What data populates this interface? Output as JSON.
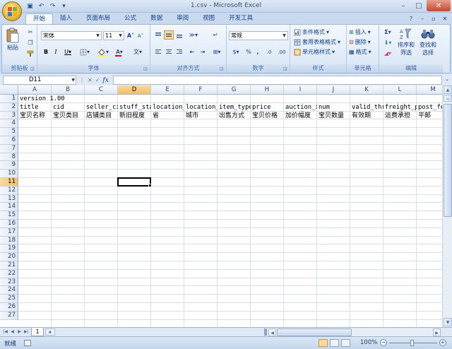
{
  "window": {
    "title": "1.csv - Microsoft Excel"
  },
  "tabs": [
    "开始",
    "插入",
    "页面布局",
    "公式",
    "数据",
    "审阅",
    "视图",
    "开发工具"
  ],
  "ribbon": {
    "clipboard": {
      "label": "剪贴板",
      "paste": "粘贴"
    },
    "font": {
      "label": "字体",
      "name": "宋体",
      "size": "11",
      "bold": "B",
      "italic": "I",
      "underline": "U",
      "grow": "A",
      "shrink": "A",
      "color_letter": "A",
      "phonetic": "文"
    },
    "alignment": {
      "label": "对齐方式"
    },
    "number": {
      "label": "数字",
      "format": "常规",
      "percent": "%",
      "comma": ",",
      "dec_inc": ".0",
      "dec_dec": ".00"
    },
    "styles": {
      "label": "样式",
      "conditional": "条件格式",
      "table": "套用表格格式",
      "cell_styles": "单元格样式"
    },
    "cells": {
      "label": "单元格",
      "insert": "插入",
      "delete": "删除",
      "format": "格式"
    },
    "editing": {
      "label": "编辑",
      "sigma": "Σ",
      "sort": "排序和",
      "sort2": "筛选",
      "find": "查找和",
      "find2": "选择"
    }
  },
  "formula_bar": {
    "name_box": "D11",
    "fx": "fx",
    "value": ""
  },
  "grid": {
    "columns": [
      "A",
      "B",
      "C",
      "D",
      "E",
      "F",
      "G",
      "H",
      "I",
      "J",
      "K",
      "L",
      "M"
    ],
    "rows": [
      "1",
      "2",
      "3",
      "4",
      "5",
      "6",
      "7",
      "8",
      "9",
      "10",
      "11",
      "12",
      "13",
      "14",
      "15",
      "16",
      "17",
      "18",
      "19",
      "20",
      "21",
      "22",
      "23",
      "24",
      "25",
      "26",
      "27"
    ],
    "cells": [
      {
        "row": 0,
        "col": 0,
        "text": "version 1.00",
        "mono": true
      },
      {
        "row": 1,
        "col": 0,
        "text": "title",
        "mono": true
      },
      {
        "row": 1,
        "col": 1,
        "text": "cid",
        "mono": true
      },
      {
        "row": 1,
        "col": 2,
        "text": "seller_ci",
        "mono": true
      },
      {
        "row": 1,
        "col": 3,
        "text": "stuff_sta",
        "mono": true
      },
      {
        "row": 1,
        "col": 4,
        "text": "location_",
        "mono": true
      },
      {
        "row": 1,
        "col": 5,
        "text": "location_",
        "mono": true
      },
      {
        "row": 1,
        "col": 6,
        "text": "item_type",
        "mono": true
      },
      {
        "row": 1,
        "col": 7,
        "text": "price",
        "mono": true
      },
      {
        "row": 1,
        "col": 8,
        "text": "auction_i",
        "mono": true
      },
      {
        "row": 1,
        "col": 9,
        "text": "num",
        "mono": true
      },
      {
        "row": 1,
        "col": 10,
        "text": "valid_thr",
        "mono": true
      },
      {
        "row": 1,
        "col": 11,
        "text": "freight_p",
        "mono": true
      },
      {
        "row": 1,
        "col": 12,
        "text": "post_fe",
        "mono": true
      },
      {
        "row": 2,
        "col": 0,
        "text": "宝贝名称"
      },
      {
        "row": 2,
        "col": 1,
        "text": "宝贝类目"
      },
      {
        "row": 2,
        "col": 2,
        "text": "店铺类目"
      },
      {
        "row": 2,
        "col": 3,
        "text": "新旧程度"
      },
      {
        "row": 2,
        "col": 4,
        "text": "省"
      },
      {
        "row": 2,
        "col": 5,
        "text": "城市"
      },
      {
        "row": 2,
        "col": 6,
        "text": "出售方式"
      },
      {
        "row": 2,
        "col": 7,
        "text": "宝贝价格"
      },
      {
        "row": 2,
        "col": 8,
        "text": "加价幅度"
      },
      {
        "row": 2,
        "col": 9,
        "text": "宝贝数量"
      },
      {
        "row": 2,
        "col": 10,
        "text": "有效期"
      },
      {
        "row": 2,
        "col": 11,
        "text": "运费承担"
      },
      {
        "row": 2,
        "col": 12,
        "text": "平邮"
      }
    ],
    "active": {
      "row": 10,
      "col": 3
    }
  },
  "sheets": {
    "tab": "1"
  },
  "status": {
    "ready": "就绪",
    "zoom": "100%"
  },
  "colors": {
    "accent": "#15428b",
    "ribbon_bg": "#dfe9f5",
    "selected_header": "#f1c15f"
  }
}
